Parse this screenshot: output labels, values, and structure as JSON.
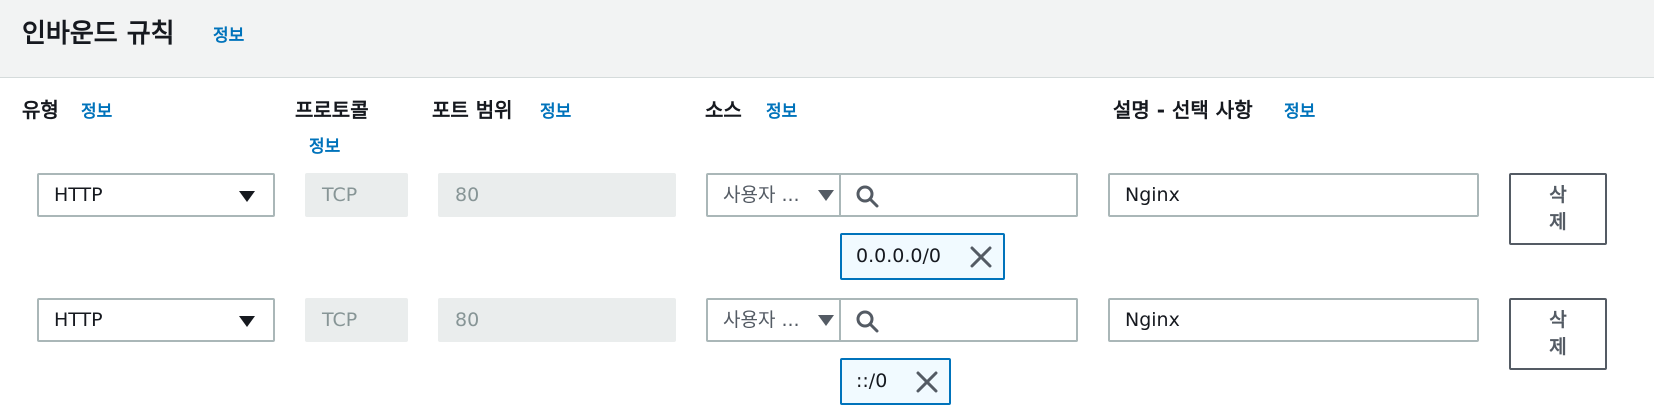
{
  "header": {
    "title": "인바운드 규칙",
    "info": "정보"
  },
  "columns": {
    "type": {
      "label": "유형",
      "info": "정보"
    },
    "protocol": {
      "label": "프로토콜",
      "info": "정보"
    },
    "port_range": {
      "label": "포트 범위",
      "info": "정보"
    },
    "source": {
      "label": "소스",
      "info": "정보"
    },
    "description": {
      "label": "설명 - 선택 사항",
      "info": "정보"
    }
  },
  "rules": [
    {
      "type": "HTTP",
      "protocol": "TCP",
      "port_range": "80",
      "source_type": "사용자 ...",
      "source_search": "",
      "cidr": "0.0.0.0/0",
      "description": "Nginx",
      "delete_label": "삭제"
    },
    {
      "type": "HTTP",
      "protocol": "TCP",
      "port_range": "80",
      "source_type": "사용자 ...",
      "source_search": "",
      "cidr": "::/0",
      "description": "Nginx",
      "delete_label": "삭제"
    }
  ],
  "icons": {
    "search": "search-icon",
    "remove_token": "close-icon",
    "dropdown": "caret-down-icon"
  },
  "colors": {
    "link": "#0073bb",
    "token_border": "#0073bb",
    "token_bg": "#f1faff",
    "header_bg": "#f2f3f3"
  }
}
